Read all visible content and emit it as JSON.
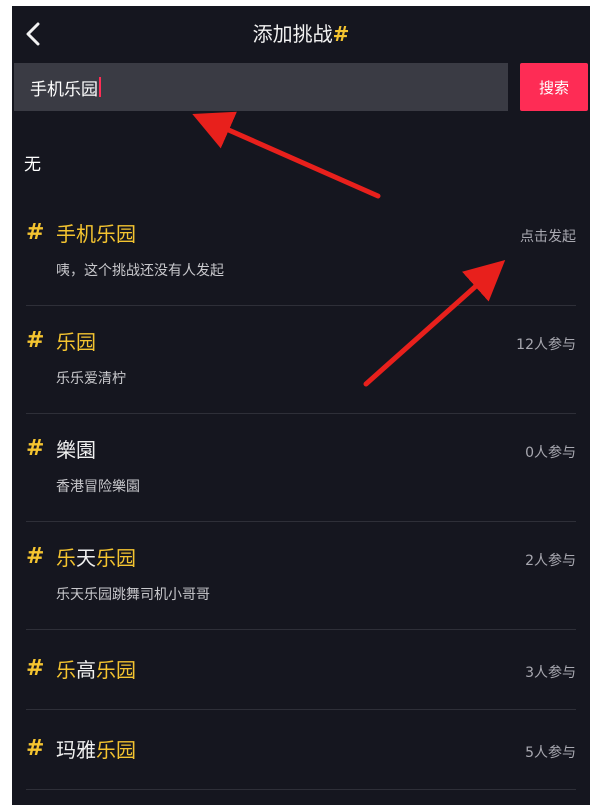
{
  "header": {
    "title": "添加挑战",
    "title_hash": "#",
    "back_icon": "chevron-left-icon"
  },
  "search": {
    "value": "手机乐园",
    "button_label": "搜索"
  },
  "no_result_label": "无",
  "challenges": [
    {
      "title_parts": [
        {
          "text": "手机乐园",
          "hl": true
        }
      ],
      "subtitle": "咦，这个挑战还没有人发起",
      "right": "点击发起"
    },
    {
      "title_parts": [
        {
          "text": "乐园",
          "hl": true
        }
      ],
      "subtitle": "乐乐爱清柠",
      "right": "12人参与"
    },
    {
      "title_parts": [
        {
          "text": "樂園",
          "hl": false
        }
      ],
      "subtitle": "香港冒险樂園",
      "right": "0人参与"
    },
    {
      "title_parts": [
        {
          "text": "乐",
          "hl": true
        },
        {
          "text": "天",
          "hl": false
        },
        {
          "text": "乐园",
          "hl": true
        }
      ],
      "subtitle": "乐天乐园跳舞司机小哥哥",
      "right": "2人参与"
    },
    {
      "title_parts": [
        {
          "text": "乐",
          "hl": true
        },
        {
          "text": "高",
          "hl": false
        },
        {
          "text": "乐园",
          "hl": true
        }
      ],
      "subtitle": "",
      "right": "3人参与"
    },
    {
      "title_parts": [
        {
          "text": "玛雅",
          "hl": false
        },
        {
          "text": "乐园",
          "hl": true
        }
      ],
      "subtitle": "",
      "right": "5人参与"
    }
  ],
  "colors": {
    "accent": "#fe2c55",
    "highlight": "#f4c430",
    "background": "#15161f",
    "annotation_arrow": "#e8201c"
  }
}
